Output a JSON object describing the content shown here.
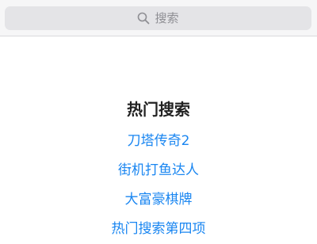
{
  "search": {
    "placeholder": "搜索",
    "icon": "search-icon"
  },
  "hot_searches": {
    "title": "热门搜索",
    "link_color": "#1a86f1",
    "items": [
      {
        "label": "刀塔传奇2"
      },
      {
        "label": "街机打鱼达人"
      },
      {
        "label": "大富豪棋牌"
      },
      {
        "label": "热门搜索第四项"
      }
    ]
  }
}
